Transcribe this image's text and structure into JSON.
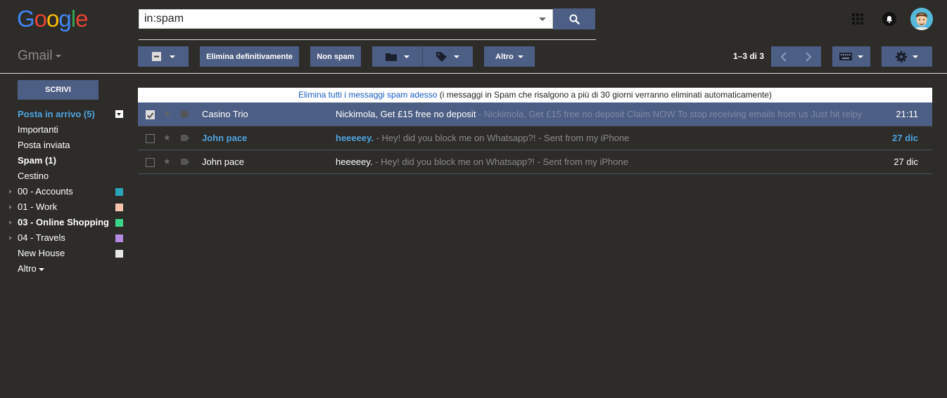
{
  "header": {
    "logo_letters": [
      {
        "ch": "G",
        "color": "#4285f4"
      },
      {
        "ch": "o",
        "color": "#ea4335"
      },
      {
        "ch": "o",
        "color": "#fbbc05"
      },
      {
        "ch": "g",
        "color": "#4285f4"
      },
      {
        "ch": "l",
        "color": "#34a853"
      },
      {
        "ch": "e",
        "color": "#ea4335"
      }
    ],
    "search_value": "in:spam",
    "icons": [
      "apps-icon",
      "notifications-icon",
      "avatar"
    ]
  },
  "toolbar": {
    "app_label": "Gmail",
    "select_icon": "checkbox-minus-icon",
    "delete_forever": "Elimina definitivamente",
    "not_spam": "Non spam",
    "move_icon": "folder-icon",
    "labels_icon": "label-icon",
    "more": "Altro",
    "pagination": "1–3 di 3",
    "keyboard_icon": "keyboard-icon",
    "settings_icon": "gear-icon"
  },
  "sidebar": {
    "compose": "SCRIVI",
    "items": [
      {
        "label": "Posta in arrivo (5)",
        "active": true,
        "menu": true
      },
      {
        "label": "Importanti"
      },
      {
        "label": "Posta inviata"
      },
      {
        "label": "Spam (1)",
        "bold": true
      },
      {
        "label": "Cestino"
      },
      {
        "label": "00 - Accounts",
        "expand": true,
        "color": "#2aa6b8"
      },
      {
        "label": "01 - Work",
        "expand": true,
        "color": "#f6c5b0"
      },
      {
        "label": "03 - Online Shopping",
        "expand": true,
        "color": "#3ad48a",
        "bold": true
      },
      {
        "label": "04 - Travels",
        "expand": true,
        "color": "#b28ae0"
      },
      {
        "label": "New House",
        "color": "#e8e8e8"
      }
    ],
    "more": "Altro"
  },
  "banner": {
    "link": "Elimina tutti i messaggi spam adesso",
    "text": " (i messaggi in Spam che risalgono a più di 30 giorni verranno eliminati automaticamente)"
  },
  "emails": [
    {
      "sender": "Casino Trio",
      "subject": "Nickimola, Get £15 free no deposit",
      "snippet": " - Nickimola, Get £15 free no deposit Claim NOW To stop receiving emails from us Just hit relpy",
      "date": "21:11",
      "selected": true,
      "unread": false
    },
    {
      "sender": "John pace",
      "subject": "heeeeey.",
      "snippet": " - Hey! did you block me on Whatsapp?! - Sent from my iPhone",
      "date": "27 dic",
      "selected": false,
      "unread": true
    },
    {
      "sender": "John pace",
      "subject": "heeeeey.",
      "snippet": " - Hey! did you block me on Whatsapp?! - Sent from my iPhone",
      "date": "27 dic",
      "selected": false,
      "unread": false
    }
  ]
}
